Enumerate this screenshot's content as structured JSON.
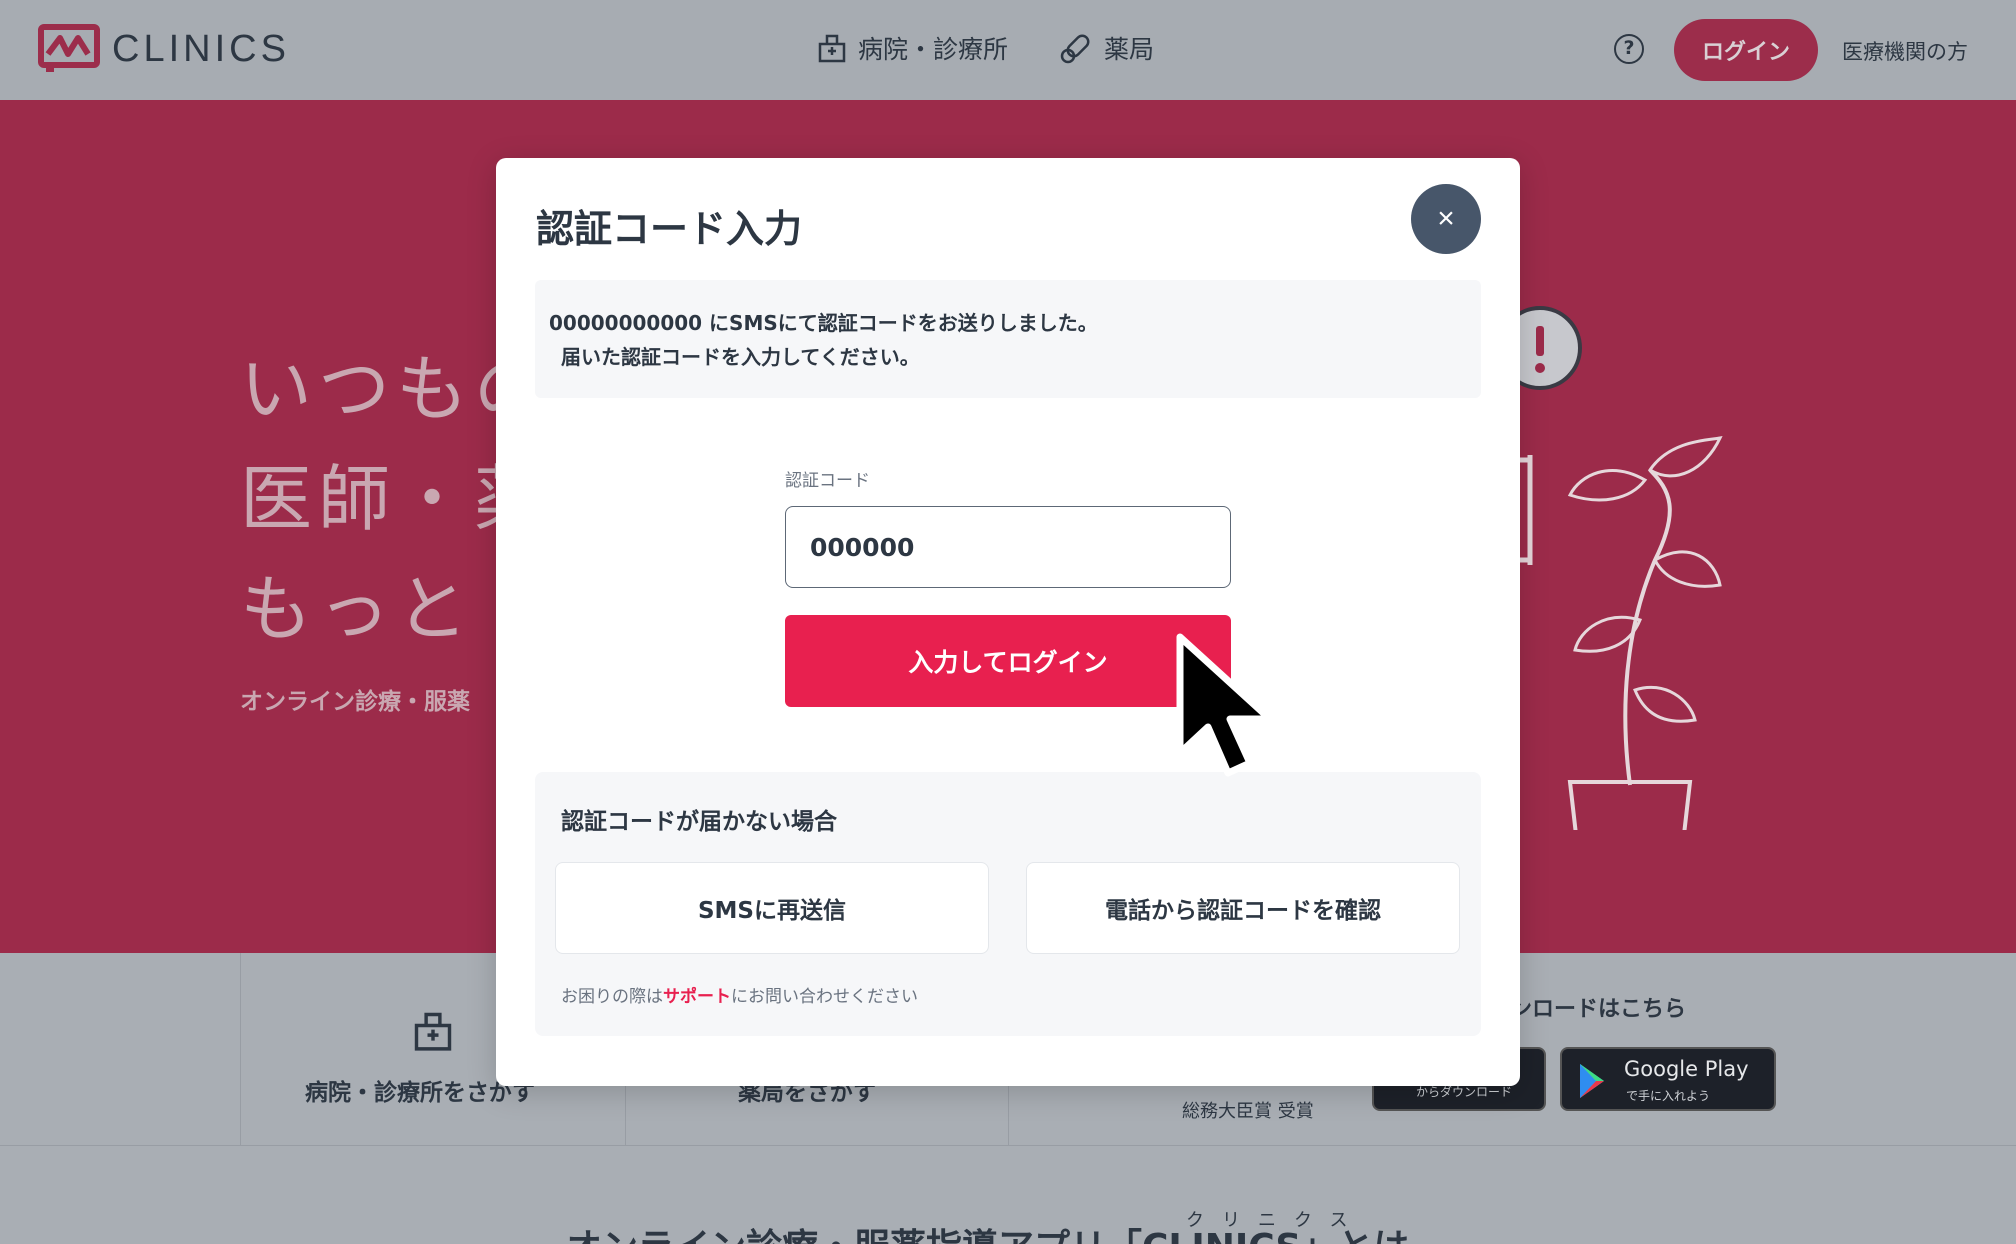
{
  "header": {
    "logo_text": "CLINICS",
    "nav": [
      {
        "label": "病院・診療所",
        "icon": "hospital-icon"
      },
      {
        "label": "薬局",
        "icon": "pill-icon"
      }
    ],
    "help_icon_glyph": "?",
    "login_label": "ログイン",
    "medical_link": "医療機関の方"
  },
  "hero": {
    "lines": [
      "いつもの",
      "医師・薬",
      "もっと"
    ],
    "sub": "オンライン診療・服薬"
  },
  "cards": {
    "hospital_label": "病院・診療所をさがす",
    "pharmacy_label": "薬局をさがす",
    "download_title": "ンロードはこちら",
    "award": "総務大臣賞 受賞",
    "appstore_sub": "からダウンロード",
    "googleplay_title": "Google Play",
    "googleplay_sub": "で手に入れよう"
  },
  "bottom": {
    "title": "オンライン診療・服薬指導アプリ「CLINICS」とは",
    "ruby": "クリニクス"
  },
  "modal": {
    "title": "認証コード入力",
    "close_glyph": "×",
    "info_line1": "00000000000 にSMSにて認証コードをお送りしました。",
    "info_line2": "届いた認証コードを入力してください。",
    "code_label": "認証コード",
    "code_value": "000000",
    "submit_label": "入力してログイン",
    "help_title": "認証コードが届かない場合",
    "resend_label": "SMSに再送信",
    "phone_label": "電話から認証コードを確認",
    "support_prefix": "お困りの際は",
    "support_link": "サポート",
    "support_suffix": "にお問い合わせください"
  },
  "colors": {
    "brand": "#e8204f",
    "hero_bg": "#9c2b4a",
    "overlay": "#a9aeb4",
    "close_bg": "#47566a",
    "text": "#2d3743"
  }
}
